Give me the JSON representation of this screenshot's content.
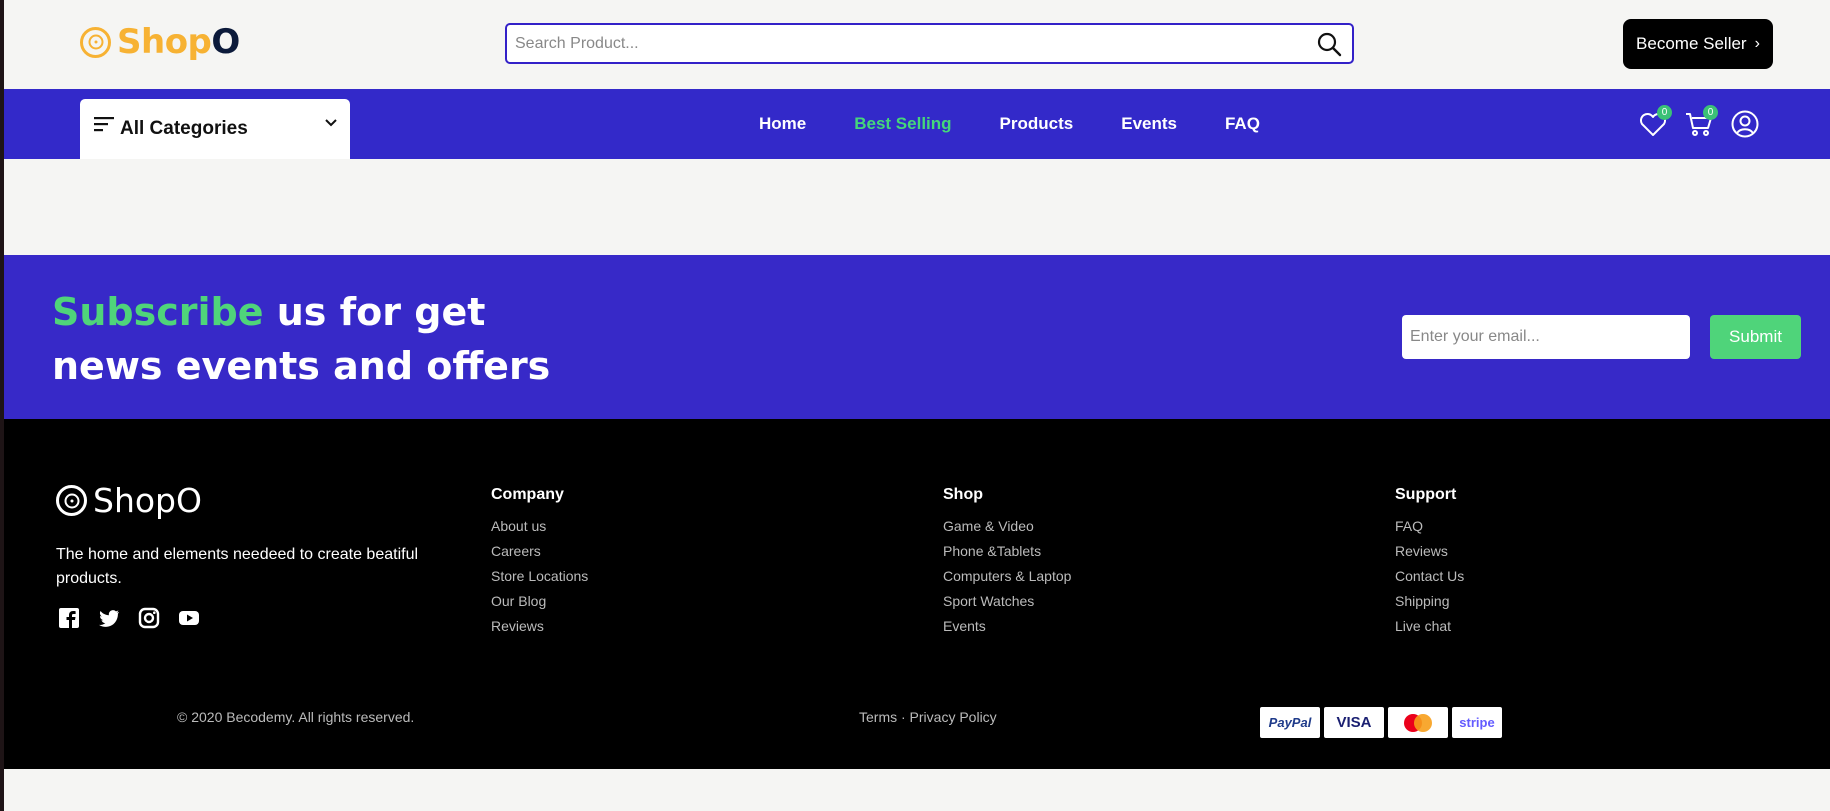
{
  "header": {
    "logo_text_a": "Shop",
    "logo_text_b": "O",
    "search_placeholder": "Search Product...",
    "become_seller": "Become Seller",
    "become_seller_chevron": "›"
  },
  "nav": {
    "categories_label": "All Categories",
    "links": [
      "Home",
      "Best Selling",
      "Products",
      "Events",
      "FAQ"
    ],
    "active_link": "Best Selling",
    "wishlist_count": "0",
    "cart_count": "0"
  },
  "subscribe": {
    "highlight": "Subscribe",
    "rest": " us for get news events and offers",
    "email_placeholder": "Enter your email...",
    "submit_label": "Submit"
  },
  "footer": {
    "logo_text": "ShopO",
    "description": "The home and elements needeed to create beatiful products.",
    "columns": [
      {
        "title": "Company",
        "items": [
          "About us",
          "Careers",
          "Store Locations",
          "Our Blog",
          "Reviews"
        ]
      },
      {
        "title": "Shop",
        "items": [
          "Game & Video",
          "Phone &Tablets",
          "Computers & Laptop",
          "Sport Watches",
          "Events"
        ]
      },
      {
        "title": "Support",
        "items": [
          "FAQ",
          "Reviews",
          "Contact Us",
          "Shipping",
          "Live chat"
        ]
      }
    ],
    "copyright": "© 2020 Becodemy. All rights reserved.",
    "legal": "Terms · Privacy Policy",
    "payments": {
      "paypal": "PayPal",
      "visa": "VISA",
      "stripe": "stripe"
    }
  },
  "colors": {
    "brand_yellow": "#f7b233",
    "nav_blue": "#3329c9",
    "accent_green": "#4fd47a",
    "footer_black": "#000000"
  }
}
